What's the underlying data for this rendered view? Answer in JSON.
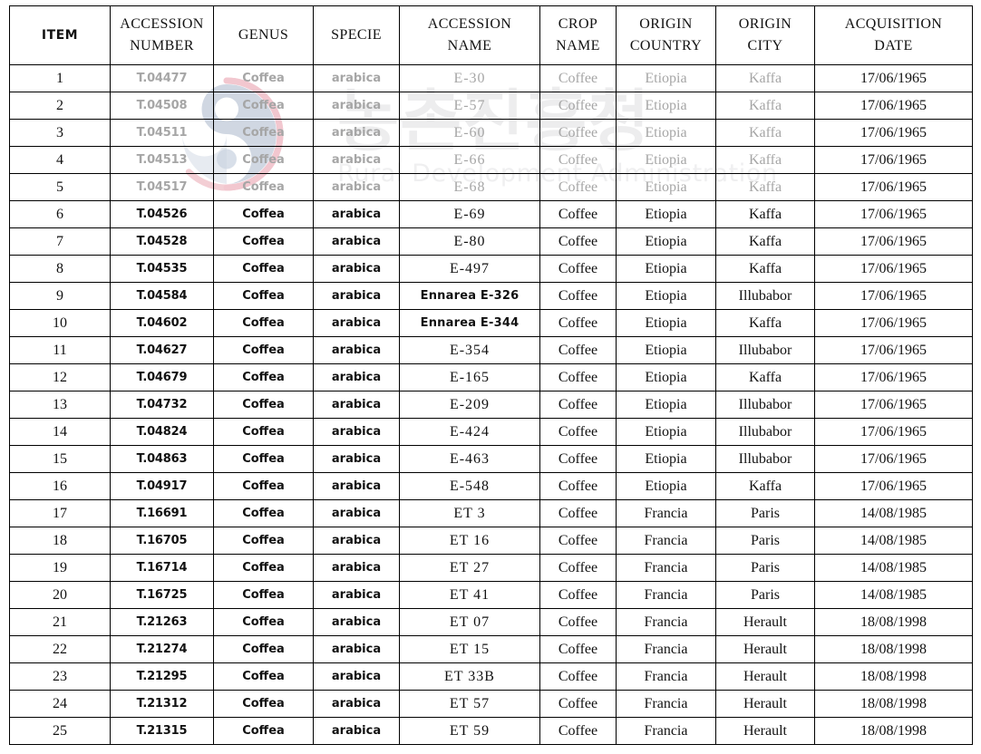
{
  "watermark": {
    "emblem_icon": "rda-swirl-emblem-icon",
    "korean_text": "농촌진흥청",
    "english_text": "Rural Development Administration",
    "colors": {
      "text": "#ededee",
      "emblem_red": "#f0c3cb",
      "emblem_blue": "#c6cfdd"
    }
  },
  "table": {
    "columns": [
      {
        "key": "item",
        "lines": [
          "ITEM"
        ]
      },
      {
        "key": "accnum",
        "lines": [
          "ACCESSION",
          "NUMBER"
        ]
      },
      {
        "key": "genus",
        "lines": [
          "GENUS"
        ]
      },
      {
        "key": "specie",
        "lines": [
          "SPECIE"
        ]
      },
      {
        "key": "accname",
        "lines": [
          "ACCESSION",
          "NAME"
        ]
      },
      {
        "key": "crop",
        "lines": [
          "CROP",
          "NAME"
        ]
      },
      {
        "key": "country",
        "lines": [
          "ORIGIN",
          "COUNTRY"
        ]
      },
      {
        "key": "city",
        "lines": [
          "ORIGIN",
          "CITY"
        ]
      },
      {
        "key": "date",
        "lines": [
          "ACQUISITION",
          "DATE"
        ]
      }
    ],
    "rows": [
      {
        "item": "1",
        "accnum": "T.04477",
        "genus": "Coffea",
        "specie": "arabica",
        "accname": "E-30",
        "crop": "Coffee",
        "country": "Etiopia",
        "city": "Kaffa",
        "date": "17/06/1965",
        "faded": true,
        "accname_sans": false
      },
      {
        "item": "2",
        "accnum": "T.04508",
        "genus": "Coffea",
        "specie": "arabica",
        "accname": "E-57",
        "crop": "Coffee",
        "country": "Etiopia",
        "city": "Kaffa",
        "date": "17/06/1965",
        "faded": true,
        "accname_sans": false
      },
      {
        "item": "3",
        "accnum": "T.04511",
        "genus": "Coffea",
        "specie": "arabica",
        "accname": "E-60",
        "crop": "Coffee",
        "country": "Etiopia",
        "city": "Kaffa",
        "date": "17/06/1965",
        "faded": true,
        "accname_sans": false
      },
      {
        "item": "4",
        "accnum": "T.04513",
        "genus": "Coffea",
        "specie": "arabica",
        "accname": "E-66",
        "crop": "Coffee",
        "country": "Etiopia",
        "city": "Kaffa",
        "date": "17/06/1965",
        "faded": true,
        "accname_sans": false
      },
      {
        "item": "5",
        "accnum": "T.04517",
        "genus": "Coffea",
        "specie": "arabica",
        "accname": "E-68",
        "crop": "Coffee",
        "country": "Etiopia",
        "city": "Kaffa",
        "date": "17/06/1965",
        "faded": true,
        "accname_sans": false
      },
      {
        "item": "6",
        "accnum": "T.04526",
        "genus": "Coffea",
        "specie": "arabica",
        "accname": "E-69",
        "crop": "Coffee",
        "country": "Etiopia",
        "city": "Kaffa",
        "date": "17/06/1965",
        "faded": false,
        "accname_sans": false
      },
      {
        "item": "7",
        "accnum": "T.04528",
        "genus": "Coffea",
        "specie": "arabica",
        "accname": "E-80",
        "crop": "Coffee",
        "country": "Etiopia",
        "city": "Kaffa",
        "date": "17/06/1965",
        "faded": false,
        "accname_sans": false
      },
      {
        "item": "8",
        "accnum": "T.04535",
        "genus": "Coffea",
        "specie": "arabica",
        "accname": "E-497",
        "crop": "Coffee",
        "country": "Etiopia",
        "city": "Kaffa",
        "date": "17/06/1965",
        "faded": false,
        "accname_sans": false
      },
      {
        "item": "9",
        "accnum": "T.04584",
        "genus": "Coffea",
        "specie": "arabica",
        "accname": "Ennarea E-326",
        "crop": "Coffee",
        "country": "Etiopia",
        "city": "Illubabor",
        "date": "17/06/1965",
        "faded": false,
        "accname_sans": true
      },
      {
        "item": "10",
        "accnum": "T.04602",
        "genus": "Coffea",
        "specie": "arabica",
        "accname": "Ennarea E-344",
        "crop": "Coffee",
        "country": "Etiopia",
        "city": "Kaffa",
        "date": "17/06/1965",
        "faded": false,
        "accname_sans": true
      },
      {
        "item": "11",
        "accnum": "T.04627",
        "genus": "Coffea",
        "specie": "arabica",
        "accname": "E-354",
        "crop": "Coffee",
        "country": "Etiopia",
        "city": "Illubabor",
        "date": "17/06/1965",
        "faded": false,
        "accname_sans": false
      },
      {
        "item": "12",
        "accnum": "T.04679",
        "genus": "Coffea",
        "specie": "arabica",
        "accname": "E-165",
        "crop": "Coffee",
        "country": "Etiopia",
        "city": "Kaffa",
        "date": "17/06/1965",
        "faded": false,
        "accname_sans": false
      },
      {
        "item": "13",
        "accnum": "T.04732",
        "genus": "Coffea",
        "specie": "arabica",
        "accname": "E-209",
        "crop": "Coffee",
        "country": "Etiopia",
        "city": "Illubabor",
        "date": "17/06/1965",
        "faded": false,
        "accname_sans": false
      },
      {
        "item": "14",
        "accnum": "T.04824",
        "genus": "Coffea",
        "specie": "arabica",
        "accname": "E-424",
        "crop": "Coffee",
        "country": "Etiopia",
        "city": "Illubabor",
        "date": "17/06/1965",
        "faded": false,
        "accname_sans": false
      },
      {
        "item": "15",
        "accnum": "T.04863",
        "genus": "Coffea",
        "specie": "arabica",
        "accname": "E-463",
        "crop": "Coffee",
        "country": "Etiopia",
        "city": "Illubabor",
        "date": "17/06/1965",
        "faded": false,
        "accname_sans": false
      },
      {
        "item": "16",
        "accnum": "T.04917",
        "genus": "Coffea",
        "specie": "arabica",
        "accname": "E-548",
        "crop": "Coffee",
        "country": "Etiopia",
        "city": "Kaffa",
        "date": "17/06/1965",
        "faded": false,
        "accname_sans": false
      },
      {
        "item": "17",
        "accnum": "T.16691",
        "genus": "Coffea",
        "specie": "arabica",
        "accname": "ET 3",
        "crop": "Coffee",
        "country": "Francia",
        "city": "Paris",
        "date": "14/08/1985",
        "faded": false,
        "accname_sans": false
      },
      {
        "item": "18",
        "accnum": "T.16705",
        "genus": "Coffea",
        "specie": "arabica",
        "accname": "ET 16",
        "crop": "Coffee",
        "country": "Francia",
        "city": "Paris",
        "date": "14/08/1985",
        "faded": false,
        "accname_sans": false
      },
      {
        "item": "19",
        "accnum": "T.16714",
        "genus": "Coffea",
        "specie": "arabica",
        "accname": "ET 27",
        "crop": "Coffee",
        "country": "Francia",
        "city": "Paris",
        "date": "14/08/1985",
        "faded": false,
        "accname_sans": false
      },
      {
        "item": "20",
        "accnum": "T.16725",
        "genus": "Coffea",
        "specie": "arabica",
        "accname": "ET 41",
        "crop": "Coffee",
        "country": "Francia",
        "city": "Paris",
        "date": "14/08/1985",
        "faded": false,
        "accname_sans": false
      },
      {
        "item": "21",
        "accnum": "T.21263",
        "genus": "Coffea",
        "specie": "arabica",
        "accname": "ET 07",
        "crop": "Coffee",
        "country": "Francia",
        "city": "Herault",
        "date": "18/08/1998",
        "faded": false,
        "accname_sans": false
      },
      {
        "item": "22",
        "accnum": "T.21274",
        "genus": "Coffea",
        "specie": "arabica",
        "accname": "ET 15",
        "crop": "Coffee",
        "country": "Francia",
        "city": "Herault",
        "date": "18/08/1998",
        "faded": false,
        "accname_sans": false
      },
      {
        "item": "23",
        "accnum": "T.21295",
        "genus": "Coffea",
        "specie": "arabica",
        "accname": "ET 33B",
        "crop": "Coffee",
        "country": "Francia",
        "city": "Herault",
        "date": "18/08/1998",
        "faded": false,
        "accname_sans": false
      },
      {
        "item": "24",
        "accnum": "T.21312",
        "genus": "Coffea",
        "specie": "arabica",
        "accname": "ET 57",
        "crop": "Coffee",
        "country": "Francia",
        "city": "Herault",
        "date": "18/08/1998",
        "faded": false,
        "accname_sans": false
      },
      {
        "item": "25",
        "accnum": "T.21315",
        "genus": "Coffea",
        "specie": "arabica",
        "accname": "ET 59",
        "crop": "Coffee",
        "country": "Francia",
        "city": "Herault",
        "date": "18/08/1998",
        "faded": false,
        "accname_sans": false
      }
    ]
  }
}
